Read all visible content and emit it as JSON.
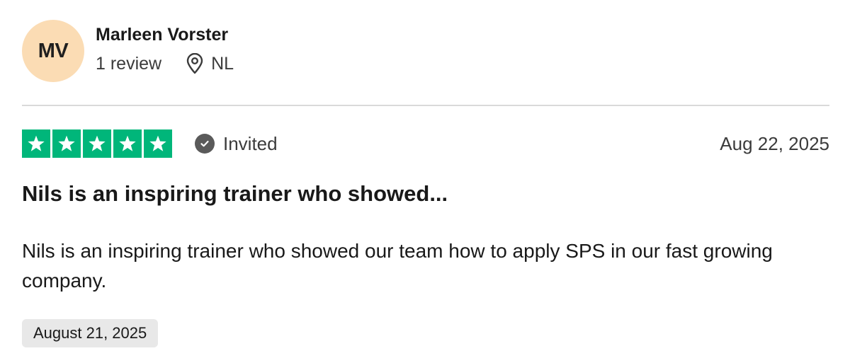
{
  "reviewer": {
    "initials": "MV",
    "name": "Marleen Vorster",
    "review_count": "1 review",
    "location": "NL",
    "avatar_color": "#fbdcb4",
    "location_icon": "location-pin-icon"
  },
  "review": {
    "rating": 5,
    "rating_max": 5,
    "star_color": "#00b67a",
    "verification_label": "Invited",
    "verification_icon": "check-circle-icon",
    "date": "Aug 22, 2025",
    "title": "Nils is an inspiring trainer who showed...",
    "body": "Nils is an inspiring trainer who showed our team how to apply SPS in our fast growing company.",
    "experience_date": "August 21, 2025"
  }
}
